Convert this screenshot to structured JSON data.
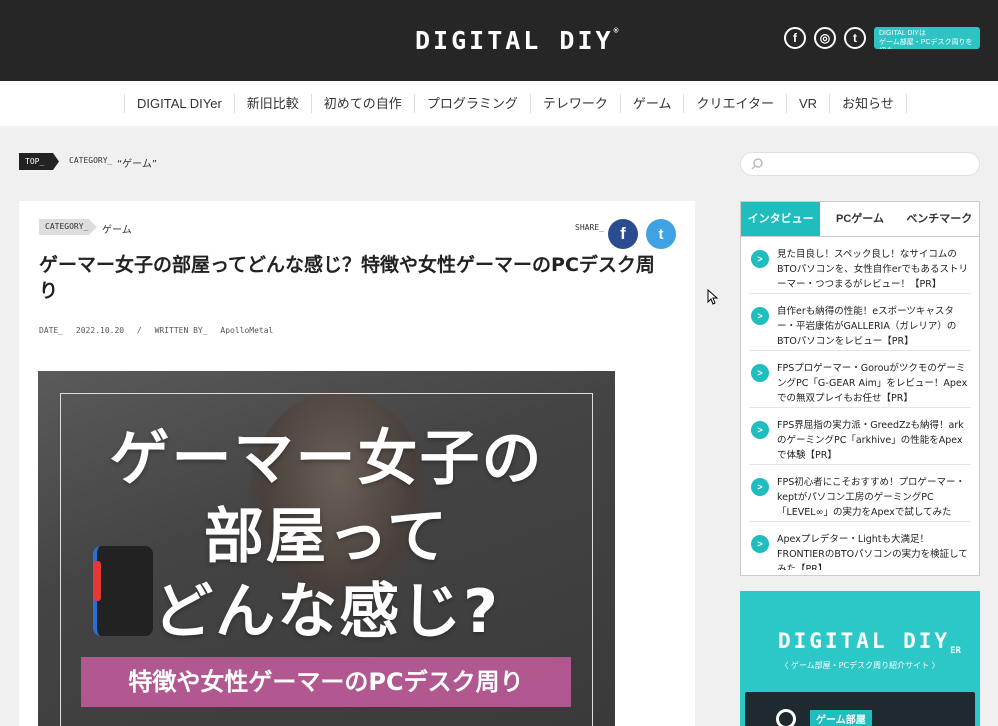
{
  "header": {
    "logo": "DIGITAL DIY",
    "logo_mark": "®",
    "social": {
      "facebook": "f",
      "instagram": "◎",
      "twitter": "t"
    },
    "badge_line1": "DIGITAL DIYは",
    "badge_line2": "ゲーム部屋・PCデスク周りを紹介"
  },
  "nav": {
    "items": [
      "DIGITAL DIYer",
      "新旧比較",
      "初めての自作",
      "プログラミング",
      "テレワーク",
      "ゲーム",
      "クリエイター",
      "VR",
      "お知らせ"
    ]
  },
  "breadcrumb": {
    "top": "TOP_",
    "category": "CATEGORY_",
    "current": "“ゲーム”"
  },
  "search": {
    "placeholder": ""
  },
  "article": {
    "category_tag": "CATEGORY_",
    "category_name": "ゲーム",
    "share_label": "SHARE_",
    "share_facebook": "f",
    "share_twitter": "t",
    "title": "ゲーマー女子の部屋ってどんな感じ？特徴や女性ゲーマーのPCデスク周り",
    "date_label": "DATE_",
    "date": "2022.10.20",
    "sep": "/",
    "written_label": "WRITTEN BY_",
    "author": "ApolloMetal",
    "hero_line1": "ゲーマー女子の",
    "hero_line2": "部屋って",
    "hero_line3": "どんな感じ?",
    "hero_sub": "特徴や女性ゲーマーのPCデスク周り"
  },
  "sidebar": {
    "tabs": [
      "インタビュー",
      "PCゲーム",
      "ベンチマーク"
    ],
    "active_tab": 0,
    "rank_marker": ">",
    "items": [
      "見た目良し！スペック良し！なサイコムのBTOパソコンを、女性自作erでもあるストリーマー・つつまるがレビュー！【PR】",
      "自作erも納得の性能！eスポーツキャスター・平岩康佑がGALLERIA（ガレリア）のBTOパソコンをレビュー【PR】",
      "FPSプロゲーマー・GorouがツクモのゲーミングPC「G-GEAR Aim」をレビュー！Apexでの無双プレイもお任せ【PR】",
      "FPS界屈指の実力派・GreedZzも納得！arkのゲーミングPC「arkhive」の性能をApexで体験【PR】",
      "FPS初心者にこそおすすめ！プロゲーマー・keptがパソコン工房のゲーミングPC「LEVEL∞」の実力をApexで試してみた【PR】",
      "Apexプレデター・Lightも大満足！FRONTIERのBTOパソコンの実力を検証してみた【PR】"
    ],
    "banner_logo": "DIGITAL DIY",
    "banner_logo_sub": "ER",
    "banner_tagline": "〈 ゲーム部屋・PCデスク周り紹介サイト 〉",
    "banner_photo_label": "ゲーム部屋"
  }
}
